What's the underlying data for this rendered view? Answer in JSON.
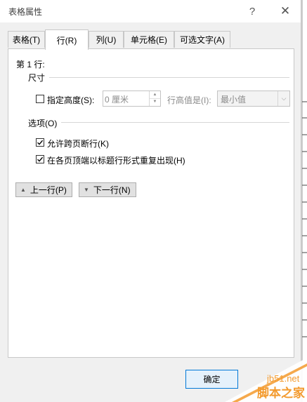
{
  "window": {
    "title": "表格属性",
    "help": "?",
    "close": "✕"
  },
  "tabs": [
    {
      "label": "表格(T)",
      "active": false
    },
    {
      "label": "行(R)",
      "active": true
    },
    {
      "label": "列(U)",
      "active": false
    },
    {
      "label": "单元格(E)",
      "active": false
    },
    {
      "label": "可选文字(A)",
      "active": false
    }
  ],
  "row_panel": {
    "row_label": "第 1 行:",
    "size_section": "尺寸",
    "specify_height_label": "指定高度(S):",
    "specify_height_checked": false,
    "height_value": "0 厘米",
    "row_height_is_label": "行高值是(I):",
    "row_height_is_value": "最小值",
    "options_section": "选项(O)",
    "allow_break_label": "允许跨页断行(K)",
    "allow_break_checked": true,
    "repeat_header_label": "在各页顶端以标题行形式重复出现(H)",
    "repeat_header_checked": true,
    "prev_row_button": "上一行(P)",
    "next_row_button": "下一行(N)"
  },
  "footer": {
    "ok_button": "确定"
  },
  "watermark": {
    "site": "jb51.net",
    "brand": "脚本之家"
  }
}
